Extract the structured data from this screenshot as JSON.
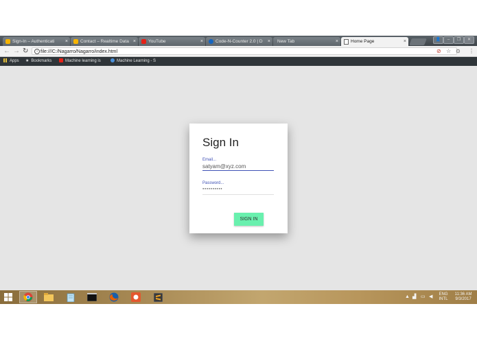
{
  "browser": {
    "tabs": [
      {
        "title": "Sign-In – Authenticati",
        "favicon_color": "#f6b400"
      },
      {
        "title": "Contact – Realtime Data",
        "favicon_color": "#f6b400"
      },
      {
        "title": "YouTube",
        "favicon_color": "#e62117"
      },
      {
        "title": "Code-N-Counter 2.0 | D",
        "favicon_color": "#1565c0"
      },
      {
        "title": "New Tab",
        "favicon_color": ""
      },
      {
        "title": "Home Page",
        "favicon_color": ""
      }
    ],
    "tab_close_glyph": "×",
    "url": "file:///C:/Nagarro/Nagarro/index.html",
    "bookmarks": [
      {
        "label": "Apps",
        "icon": "apps-grid-icon"
      },
      {
        "label": "Bookmarks",
        "icon": "star-icon"
      },
      {
        "label": "Machine learning is",
        "icon": "youtube-icon"
      },
      {
        "label": "Machine Learning - S",
        "icon": "goggle-icon"
      }
    ]
  },
  "signin": {
    "title": "Sign In",
    "email_label": "Email...",
    "email_value": "satyam@xyz.com",
    "password_label": "Password...",
    "password_value": "●●●●●●●●●●",
    "button_label": "SIGN IN",
    "accent_color": "#3f51b5",
    "button_color": "#69f0ae"
  },
  "taskbar": {
    "language": "ENG",
    "keyboard": "INTL",
    "time": "11:36 AM",
    "date": "9/3/2017"
  }
}
